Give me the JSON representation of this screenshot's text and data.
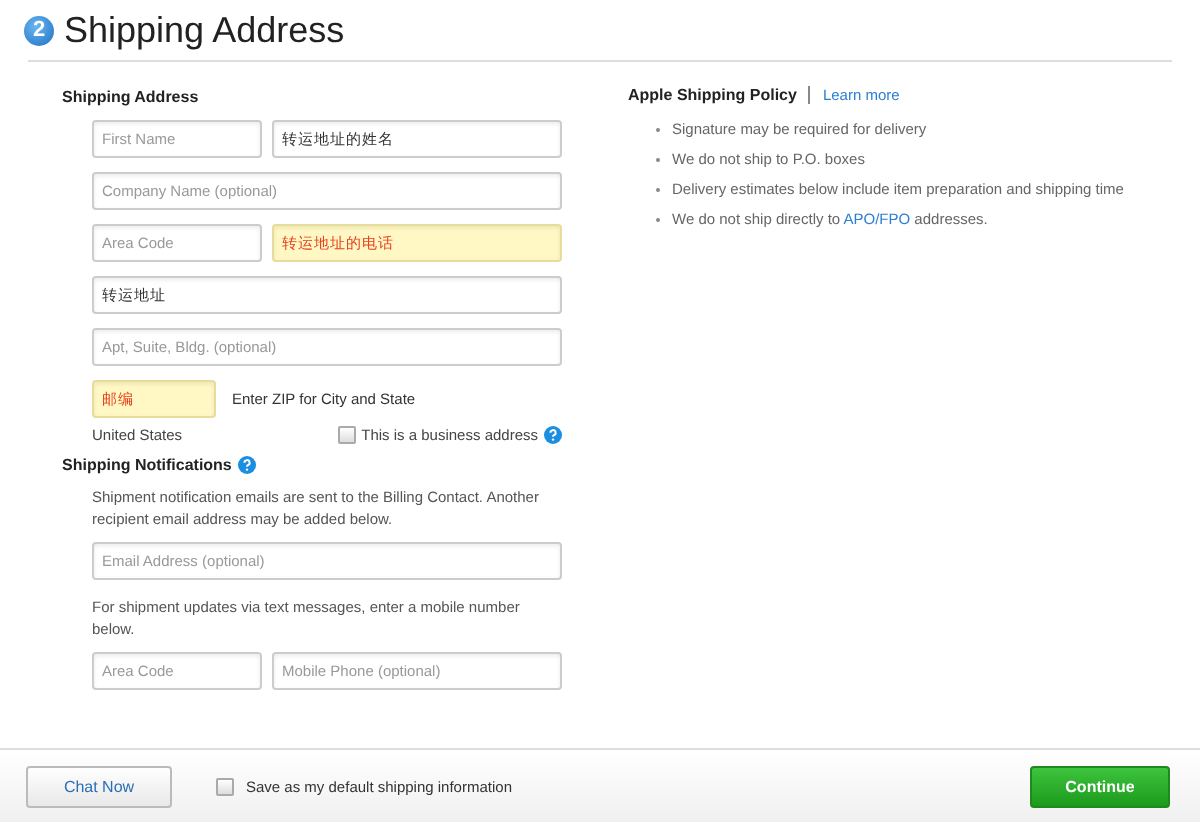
{
  "header": {
    "step": "2",
    "title": "Shipping Address"
  },
  "address": {
    "title": "Shipping Address",
    "rows": [
      {
        "fields": [
          {
            "placeholder": "First Name",
            "highlighted": false
          },
          {
            "value": "转运地址的姓名",
            "highlighted": false
          }
        ]
      },
      {
        "fields": [
          {
            "placeholder": "Company Name (optional)",
            "highlighted": false
          }
        ]
      },
      {
        "fields": [
          {
            "placeholder": "Area Code",
            "highlighted": false
          },
          {
            "value": "转运地址的电话",
            "highlighted": true
          }
        ]
      },
      {
        "fields": [
          {
            "value": "转运地址",
            "highlighted": false
          }
        ]
      },
      {
        "fields": [
          {
            "placeholder": "Apt, Suite, Bldg. (optional)",
            "highlighted": false
          }
        ]
      },
      {
        "fields": [
          {
            "value": "邮编",
            "highlighted": true
          }
        ],
        "note": "Enter ZIP for City and State"
      }
    ],
    "country": "United States",
    "business": {
      "label": "This is a business address",
      "checked": false
    }
  },
  "notifications": {
    "title": "Shipping Notifications",
    "email_text": "Shipment notification emails are sent to the Billing Contact. Another recipient email address may be added below.",
    "email_field": {
      "placeholder": "Email Address (optional)",
      "highlighted": false
    },
    "sms_text": "For shipment updates via text messages, enter a mobile number below.",
    "phone_fields": [
      {
        "placeholder": "Area Code",
        "highlighted": false
      },
      {
        "placeholder": "Mobile Phone (optional)",
        "highlighted": false
      }
    ]
  },
  "policy": {
    "title": "Apple Shipping Policy",
    "link": "Learn more",
    "items": [
      {
        "text": "Signature may be required for delivery"
      },
      {
        "text": "We do not ship to P.O. boxes"
      },
      {
        "text": "Delivery estimates below include item preparation and shipping time"
      },
      {
        "text": "We do not ship directly to",
        "link": "APO/FPO",
        "after": "addresses."
      }
    ]
  },
  "footer": {
    "chat": "Chat Now",
    "save": {
      "label": "Save as my default shipping information",
      "checked": false
    },
    "continue": "Continue"
  }
}
